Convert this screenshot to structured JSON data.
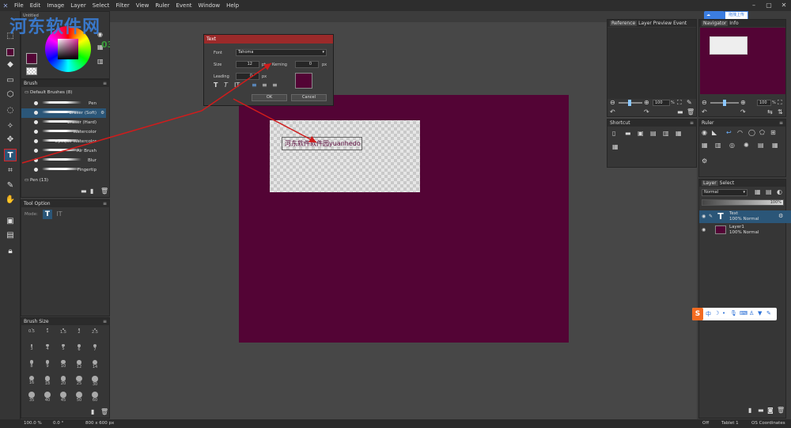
{
  "menu": {
    "items": [
      "File",
      "Edit",
      "Image",
      "Layer",
      "Select",
      "Filter",
      "View",
      "Ruler",
      "Event",
      "Window",
      "Help"
    ]
  },
  "watermark": {
    "text": "河东软件网",
    "sub": "0359.cn"
  },
  "cloud_button": "拖拽上传",
  "navigator_panel": {
    "title": "Untitled"
  },
  "text_dialog": {
    "title": "Text",
    "font_label": "Font",
    "font_value": "Tahoma",
    "size_label": "Size",
    "size_value": "12",
    "size_unit": "pt",
    "kerning_label": "Kerning",
    "kerning_value": "0",
    "kerning_unit": "px",
    "leading_label": "Leading",
    "leading_value": "0",
    "leading_unit": "px",
    "ok_label": "OK",
    "cancel_label": "Cancel",
    "color": "#530435"
  },
  "canvas": {
    "background": "#474747",
    "doc_color": "#530435",
    "text_content": "河东软件软件园yuanhedo"
  },
  "brush_panel": {
    "title": "Brush",
    "group": "Default Brushes (8)",
    "items": [
      "Pen",
      "Eraser (Soft)",
      "Eraser (Hard)",
      "Watercolor",
      "Opaque Watercolor",
      "Air Brush",
      "Blur",
      "Fingertip"
    ],
    "pen_group": "Pen (13)"
  },
  "tool_option": {
    "title": "Tool Option",
    "mode_label": "Mode:"
  },
  "brush_size": {
    "title": "Brush Size",
    "sizes": [
      "0.5",
      "1",
      "1.5",
      "2",
      "2.5",
      "3",
      "4",
      "5",
      "6",
      "7",
      "8",
      "9",
      "10",
      "12",
      "14",
      "16",
      "18",
      "20",
      "25",
      "30",
      "35",
      "40",
      "45",
      "50",
      "60"
    ]
  },
  "reference_panel": {
    "tabs": [
      "Reference",
      "Layer Preview",
      "Event Logs"
    ],
    "zoom": "100",
    "zoom_unit": "%"
  },
  "shortcut_panel": {
    "title": "Shortcut"
  },
  "navigator": {
    "tabs": [
      "Navigator",
      "Info"
    ],
    "zoom": "100",
    "zoom_unit": "%"
  },
  "ruler_panel": {
    "title": "Ruler"
  },
  "layer_panel": {
    "tabs": [
      "Layer",
      "Select"
    ],
    "blend": "Normal",
    "opacity": "100%",
    "layers": [
      {
        "name": "Text",
        "detail": "100% Normal"
      },
      {
        "name": "Layer1",
        "detail": "100% Normal"
      }
    ]
  },
  "status": {
    "zoom": "100.0 %",
    "angle": "0.0 °",
    "size": "800 x 600 px",
    "off": "Off",
    "tablet": "Tablet 1",
    "coords": "OS Coordinates"
  }
}
